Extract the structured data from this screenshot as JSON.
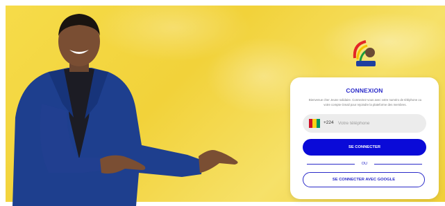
{
  "login": {
    "title": "CONNEXION",
    "description": "Bienvenue cher Jeune solidaire. Connectez-vous avec votre numéro de téléphone ou votre compte Gmail pour rejoindre la plateforme des membres.",
    "phone_prefix": "+224",
    "phone_placeholder": "Votre téléphone",
    "phone_value": "",
    "flag_icon": "guinea-flag-icon",
    "flag_colors": [
      "#ce1126",
      "#fcd116",
      "#009460"
    ],
    "login_button": "SE CONNECTER",
    "divider_text": "OU",
    "google_button": "SE CONNECTER AVEC GOOGLE"
  },
  "colors": {
    "accent": "#2a2ac9",
    "primary_button": "#0a0ad8",
    "background": "#f4d845"
  },
  "illustration": {
    "logo_icon": "organization-logo-icon"
  }
}
